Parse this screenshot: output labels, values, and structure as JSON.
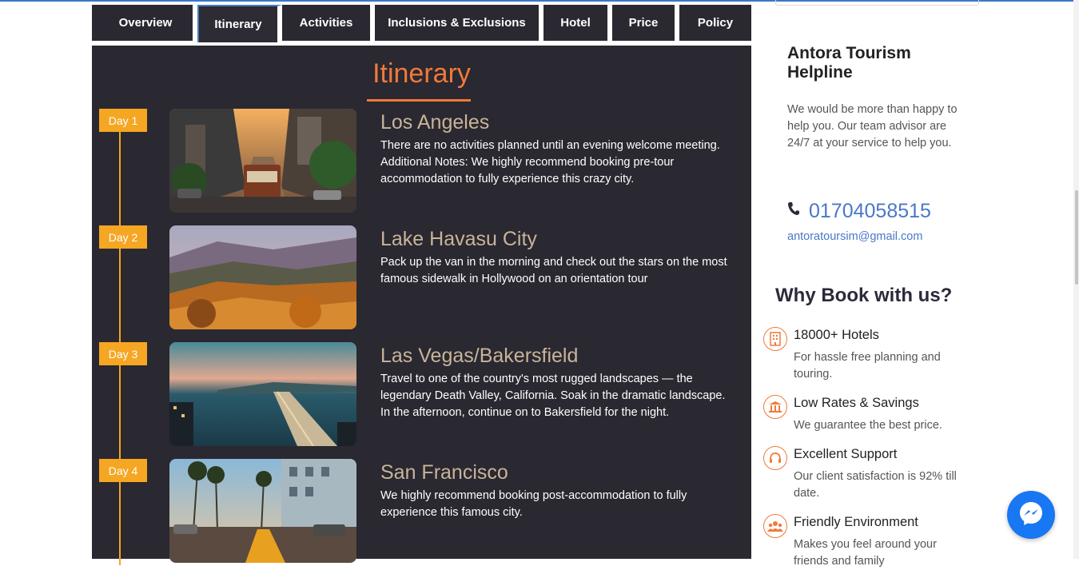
{
  "tabs": [
    {
      "label": "Overview"
    },
    {
      "label": "Itinerary"
    },
    {
      "label": "Activities"
    },
    {
      "label": "Inclusions & Exclusions"
    },
    {
      "label": "Hotel"
    },
    {
      "label": "Price"
    },
    {
      "label": "Policy"
    }
  ],
  "active_tab": "Itinerary",
  "itinerary": {
    "title": "Itinerary",
    "days": [
      {
        "badge": "Day 1",
        "title": "Los Angeles",
        "description": "There are no activities planned until an evening welcome meeting. Additional Notes: We highly recommend booking pre-tour accommodation to fully experience this crazy city."
      },
      {
        "badge": "Day 2",
        "title": "Lake Havasu City",
        "description": "Pack up the van in the morning and check out the stars on the most famous sidewalk in Hollywood on an orientation tour"
      },
      {
        "badge": "Day 3",
        "title": "Las Vegas/Bakersfield",
        "description": "Travel to one of the country's most rugged landscapes — the legendary Death Valley, California. Soak in the dramatic landscape. In the afternoon, continue on to Bakersfield for the night."
      },
      {
        "badge": "Day 4",
        "title": "San Francisco",
        "description": "We highly recommend booking post-accommodation to fully experience this famous city."
      }
    ]
  },
  "helpline": {
    "title": "Antora Tourism Helpline",
    "text": "We would be more than happy to help you. Our team advisor are 24/7 at your service to help you.",
    "phone": "01704058515",
    "email": "antoratoursim@gmail.com"
  },
  "why_book": {
    "title": "Why Book with us?",
    "features": [
      {
        "icon": "hotel-building-icon",
        "title": "18000+ Hotels",
        "description": "For hassle free planning and touring."
      },
      {
        "icon": "bank-icon",
        "title": "Low Rates & Savings",
        "description": "We guarantee the best price."
      },
      {
        "icon": "headset-icon",
        "title": "Excellent Support",
        "description": "Our client satisfaction is 92% till date."
      },
      {
        "icon": "users-icon",
        "title": "Friendly Environment",
        "description": "Makes you feel around your friends and family"
      }
    ]
  },
  "colors": {
    "panel_bg": "#2a2830",
    "accent_orange": "#f07a3a",
    "badge_yellow": "#f5a623",
    "link_blue": "#4a78c8",
    "messenger_blue": "#1877f2"
  }
}
